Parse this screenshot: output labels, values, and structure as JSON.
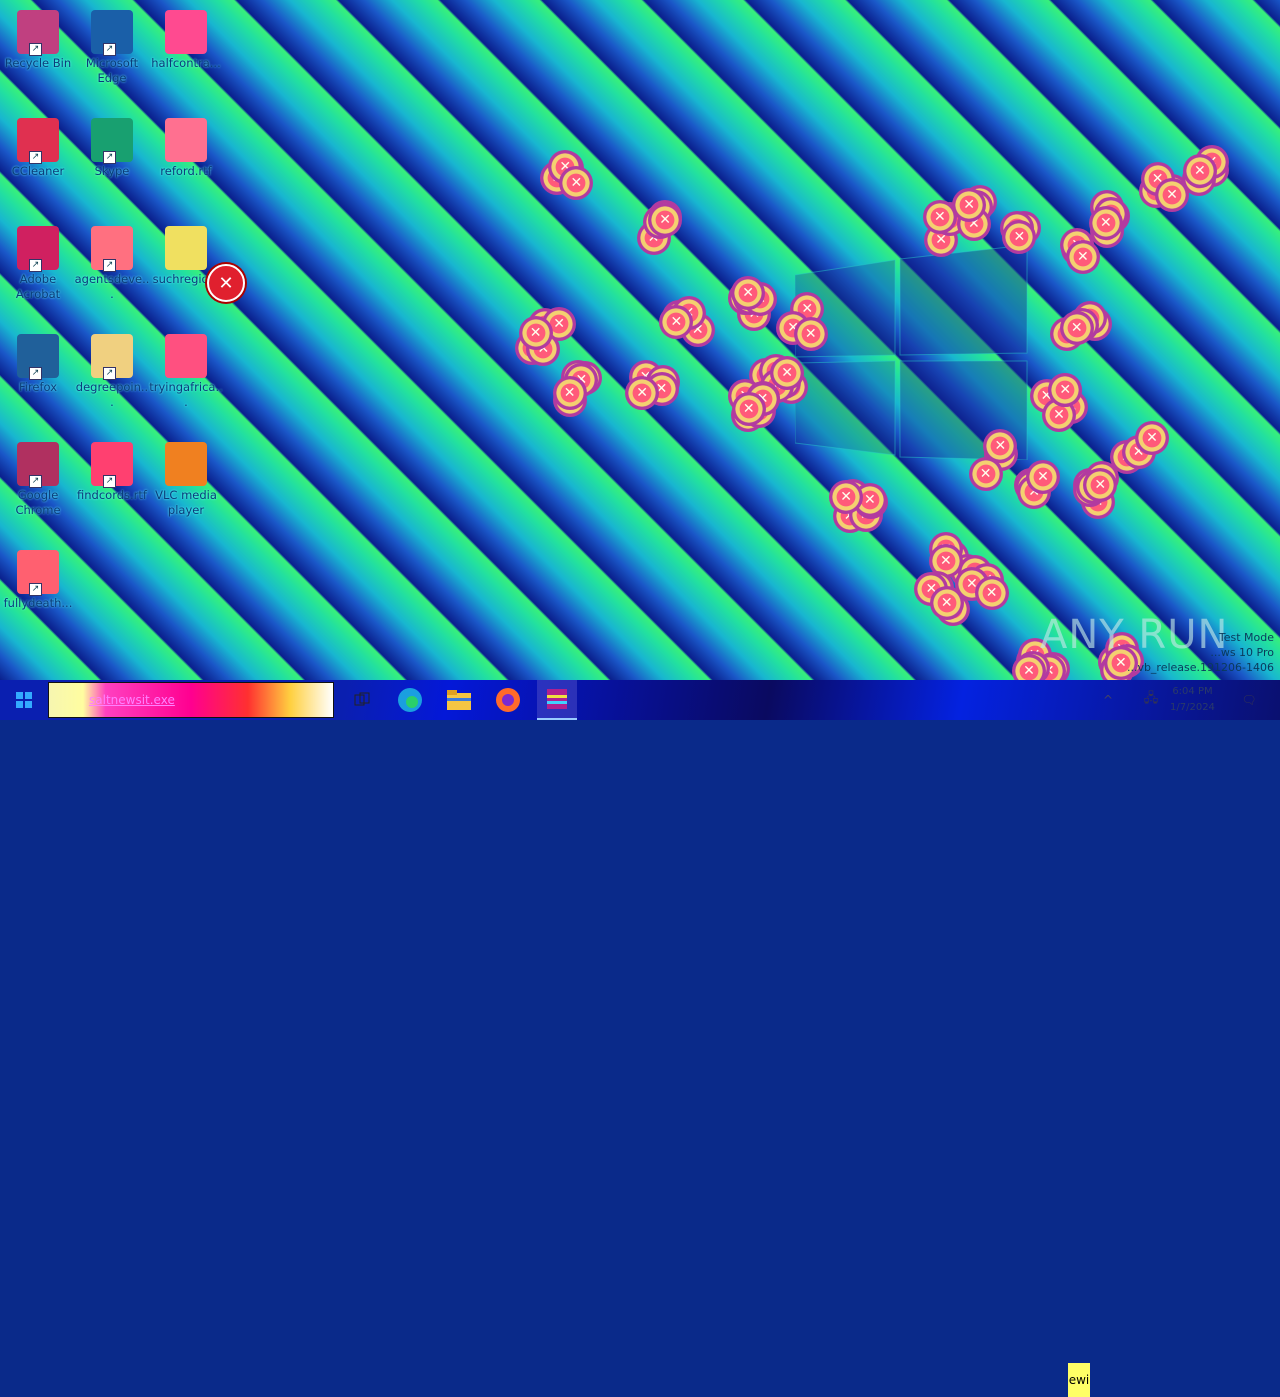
{
  "desktop": {
    "icons": [
      {
        "label": "Recycle Bin",
        "icon": "recycle-bin-icon",
        "color": "#c04080"
      },
      {
        "label": "Microsoft Edge",
        "icon": "edge-icon",
        "color": "#1a5fa8"
      },
      {
        "label": "halfcontra...",
        "icon": "image-file-icon",
        "color": "#ff4a90"
      },
      {
        "label": "CCleaner",
        "icon": "ccleaner-icon",
        "color": "#e03050"
      },
      {
        "label": "Skype",
        "icon": "skype-icon",
        "color": "#18a070"
      },
      {
        "label": "reford.rtf",
        "icon": "rtf-file-icon",
        "color": "#ff7090"
      },
      {
        "label": "Adobe Acrobat",
        "icon": "acrobat-icon",
        "color": "#d02060"
      },
      {
        "label": "agentsdeve...",
        "icon": "image-file-icon",
        "color": "#ff7080"
      },
      {
        "label": "suchregio...",
        "icon": "image-file-icon",
        "color": "#f0e060"
      },
      {
        "label": "Firefox",
        "icon": "firefox-icon",
        "color": "#20609a"
      },
      {
        "label": "degreepoin...",
        "icon": "image-file-icon",
        "color": "#f0d080"
      },
      {
        "label": "tryingafrica...",
        "icon": "rtf-file-icon",
        "color": "#ff5080"
      },
      {
        "label": "Google Chrome",
        "icon": "chrome-icon",
        "color": "#b03060"
      },
      {
        "label": "findcords.rtf",
        "icon": "rtf-file-icon",
        "color": "#ff4070"
      },
      {
        "label": "VLC media player",
        "icon": "vlc-icon",
        "color": "#f08020"
      },
      {
        "label": "fullydeath...",
        "icon": "image-file-icon",
        "color": "#ff6070"
      }
    ],
    "error_icon": "error-icon",
    "error_glyph": "✕"
  },
  "watermark": {
    "text": "ANY RUN"
  },
  "testmode": {
    "line1": "Test Mode",
    "line2": "...ws 10 Pro",
    "line3": "...vb_release.191206-1406"
  },
  "taskbar": {
    "search_text": "saltnewsit.exe",
    "apps": [
      {
        "name": "task-view",
        "icon": "task-view-icon"
      },
      {
        "name": "edge",
        "icon": "edge-icon"
      },
      {
        "name": "file-explorer",
        "icon": "folder-icon"
      },
      {
        "name": "firefox",
        "icon": "firefox-icon"
      },
      {
        "name": "winrar",
        "icon": "winrar-icon"
      }
    ],
    "tray_label": "ewi",
    "time": "6:04 PM",
    "date": "1/7/2024"
  }
}
